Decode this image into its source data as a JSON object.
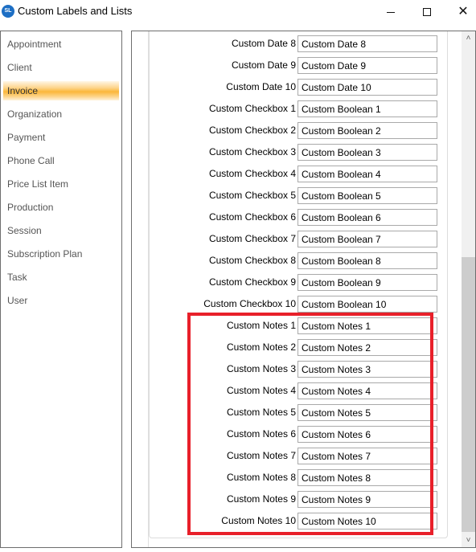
{
  "window": {
    "title": "Custom Labels and Lists",
    "app_icon": "SL",
    "controls": {
      "minimize": "minimize-icon",
      "maximize": "maximize-icon",
      "close": "close-icon",
      "close_glyph": "✕"
    }
  },
  "sidebar": {
    "items": [
      {
        "label": "Appointment",
        "selected": false
      },
      {
        "label": "Client",
        "selected": false
      },
      {
        "label": "Invoice",
        "selected": true
      },
      {
        "label": "Organization",
        "selected": false
      },
      {
        "label": "Payment",
        "selected": false
      },
      {
        "label": "Phone Call",
        "selected": false
      },
      {
        "label": "Price List Item",
        "selected": false
      },
      {
        "label": "Production",
        "selected": false
      },
      {
        "label": "Session",
        "selected": false
      },
      {
        "label": "Subscription Plan",
        "selected": false
      },
      {
        "label": "Task",
        "selected": false
      },
      {
        "label": "User",
        "selected": false
      }
    ]
  },
  "fields": [
    {
      "label": "Custom Date 8",
      "value": "Custom Date 8"
    },
    {
      "label": "Custom Date 9",
      "value": "Custom Date 9"
    },
    {
      "label": "Custom Date 10",
      "value": "Custom Date 10"
    },
    {
      "label": "Custom Checkbox 1",
      "value": "Custom Boolean 1"
    },
    {
      "label": "Custom Checkbox 2",
      "value": "Custom Boolean 2"
    },
    {
      "label": "Custom Checkbox 3",
      "value": "Custom Boolean 3"
    },
    {
      "label": "Custom Checkbox 4",
      "value": "Custom Boolean 4"
    },
    {
      "label": "Custom Checkbox 5",
      "value": "Custom Boolean 5"
    },
    {
      "label": "Custom Checkbox 6",
      "value": "Custom Boolean 6"
    },
    {
      "label": "Custom Checkbox 7",
      "value": "Custom Boolean 7"
    },
    {
      "label": "Custom Checkbox 8",
      "value": "Custom Boolean 8"
    },
    {
      "label": "Custom Checkbox 9",
      "value": "Custom Boolean 9"
    },
    {
      "label": "Custom Checkbox 10",
      "value": "Custom Boolean 10"
    },
    {
      "label": "Custom Notes 1",
      "value": "Custom Notes 1"
    },
    {
      "label": "Custom Notes 2",
      "value": "Custom Notes 2"
    },
    {
      "label": "Custom Notes 3",
      "value": "Custom Notes 3"
    },
    {
      "label": "Custom Notes 4",
      "value": "Custom Notes 4"
    },
    {
      "label": "Custom Notes 5",
      "value": "Custom Notes 5"
    },
    {
      "label": "Custom Notes 6",
      "value": "Custom Notes 6"
    },
    {
      "label": "Custom Notes 7",
      "value": "Custom Notes 7"
    },
    {
      "label": "Custom Notes 8",
      "value": "Custom Notes 8"
    },
    {
      "label": "Custom Notes 9",
      "value": "Custom Notes 9"
    },
    {
      "label": "Custom Notes 10",
      "value": "Custom Notes 10"
    }
  ],
  "scrollbar": {
    "up_glyph": "˄",
    "down_glyph": "˅",
    "scroll_position": "bottom"
  },
  "annotation": {
    "highlighted_section": "Custom Notes 1-10",
    "color": "#e8202a"
  },
  "colors": {
    "selected_item": "#fbb73a",
    "border": "#6e6e6e"
  }
}
